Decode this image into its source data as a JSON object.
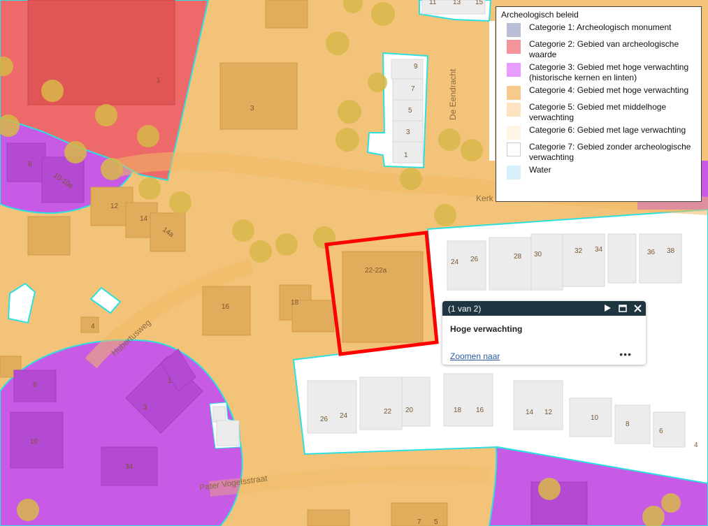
{
  "legend": {
    "title": "Archeologisch beleid",
    "items": [
      {
        "label": "Categorie 1: Archeologisch monument",
        "color": "#b9bdd6"
      },
      {
        "label": "Categorie 2: Gebied van archeologische waarde",
        "color": "#f4939a"
      },
      {
        "label": "Categorie 3: Gebied met hoge verwachting (historische kernen en linten)",
        "color": "#e89cff"
      },
      {
        "label": "Categorie 4: Gebied met hoge verwachting",
        "color": "#f6c98c"
      },
      {
        "label": "Categorie 5: Gebied met middelhoge verwachting",
        "color": "#fde3c0"
      },
      {
        "label": "Categorie 6: Gebied met lage verwachting",
        "color": "#fef5e4"
      },
      {
        "label": "Categorie 7: Gebied zonder archeologische verwachting",
        "color": "#ffffff"
      },
      {
        "label": "Water",
        "color": "#d6f1fb"
      }
    ]
  },
  "popup": {
    "counter": "(1 van 2)",
    "title": "Hoge verwachting",
    "zoom_link": "Zoomen naar",
    "more": "•••"
  },
  "streets": {
    "hubertusweg": "Hubertusweg",
    "pater_vogelsstraat": "Pater Vogelsstraat",
    "de_eendracht": "De Eendracht",
    "kerk": "Kerk"
  },
  "house_numbers": {
    "n1_red": "1",
    "n3_top": "3",
    "n8": "8",
    "n10_10a": "10-10a",
    "n12": "12",
    "n14": "14",
    "n14a": "14a",
    "n16": "16",
    "n18": "18",
    "n22_22a": "22-22a",
    "n4": "4",
    "n9": "9",
    "n7": "7",
    "n5": "5",
    "n3_e": "3",
    "n1_e": "1",
    "n11": "11",
    "n13": "13",
    "n15": "15",
    "n24a": "24",
    "n26a": "26",
    "n28": "28",
    "n30": "30",
    "n32": "32",
    "n34a": "34",
    "n36": "36",
    "n38": "38",
    "n26b": "26",
    "n24b": "24",
    "n22b": "22",
    "n20b": "20",
    "n18b": "18",
    "n16b": "16",
    "n14b": "14",
    "n12b": "12",
    "n10b": "10",
    "n8b": "8",
    "n6b": "6",
    "n4b": "4",
    "n6l": "6",
    "n10l": "10",
    "n34l": "34",
    "n1p": "1",
    "n3p": "3",
    "n7bot": "7",
    "n5bot": "5"
  },
  "colors": {
    "cat2": "#ee6a6a",
    "cat3": "#c85be6",
    "cat4": "#f3c37a",
    "cat7": "#ffffff",
    "outline": "#2de0e0",
    "selection": "#ff0000",
    "tree": "#d8b84a",
    "building": "#e2b066"
  }
}
